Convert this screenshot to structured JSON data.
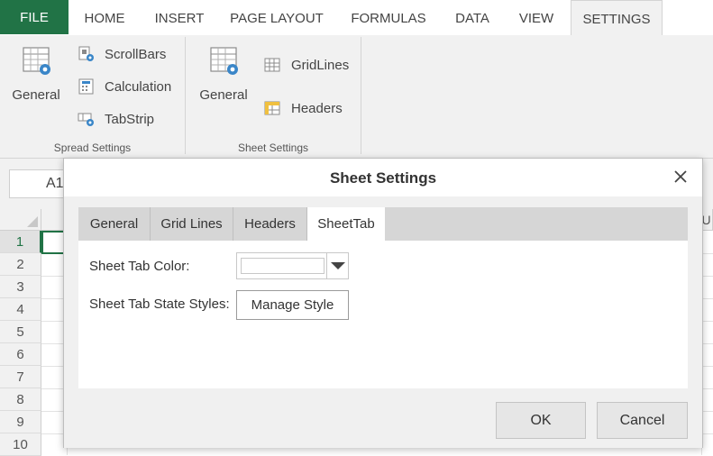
{
  "ribbon_tabs": {
    "file": "FILE",
    "home": "HOME",
    "insert": "INSERT",
    "page_layout": "PAGE LAYOUT",
    "formulas": "FORMULAS",
    "data": "DATA",
    "view": "VIEW",
    "settings": "SETTINGS"
  },
  "spread_settings": {
    "general": "General",
    "scrollbars": "ScrollBars",
    "calculation": "Calculation",
    "tabstrip": "TabStrip",
    "group_label": "Spread Settings"
  },
  "sheet_settings_group": {
    "general": "General",
    "gridlines": "GridLines",
    "headers": "Headers",
    "group_label": "Sheet Settings"
  },
  "namebox": {
    "value": "A1"
  },
  "grid": {
    "rows": [
      "1",
      "2",
      "3",
      "4",
      "5",
      "6",
      "7",
      "8",
      "9",
      "10"
    ],
    "right_col_header": "U"
  },
  "dialog": {
    "title": "Sheet Settings",
    "tabs": [
      "General",
      "Grid Lines",
      "Headers",
      "SheetTab"
    ],
    "active_tab": "SheetTab",
    "sheet_tab_color_label": "Sheet Tab Color:",
    "sheet_tab_color_value": "#ffffff",
    "tab_state_styles_label": "Sheet Tab State Styles:",
    "manage_style": "Manage Style",
    "ok": "OK",
    "cancel": "Cancel"
  },
  "colors": {
    "brand_green": "#217346",
    "ribbon_bg": "#f1f1f1",
    "dialog_tabstrip": "#d6d6d6"
  }
}
